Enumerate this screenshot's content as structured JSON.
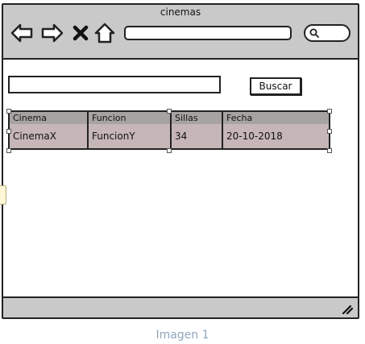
{
  "window": {
    "title": "cinemas"
  },
  "toolbar": {
    "icons": [
      "back-arrow-icon",
      "forward-arrow-icon",
      "close-icon",
      "home-icon"
    ],
    "address_value": "",
    "search_value": ""
  },
  "search": {
    "value": "",
    "button_label": "Buscar"
  },
  "table": {
    "columns": [
      "Cinema",
      "Funcion",
      "Sillas",
      "Fecha"
    ],
    "rows": [
      [
        "CinemaX",
        "FuncionY",
        "34",
        "20-10-2018"
      ]
    ]
  },
  "caption": "Imagen 1"
}
